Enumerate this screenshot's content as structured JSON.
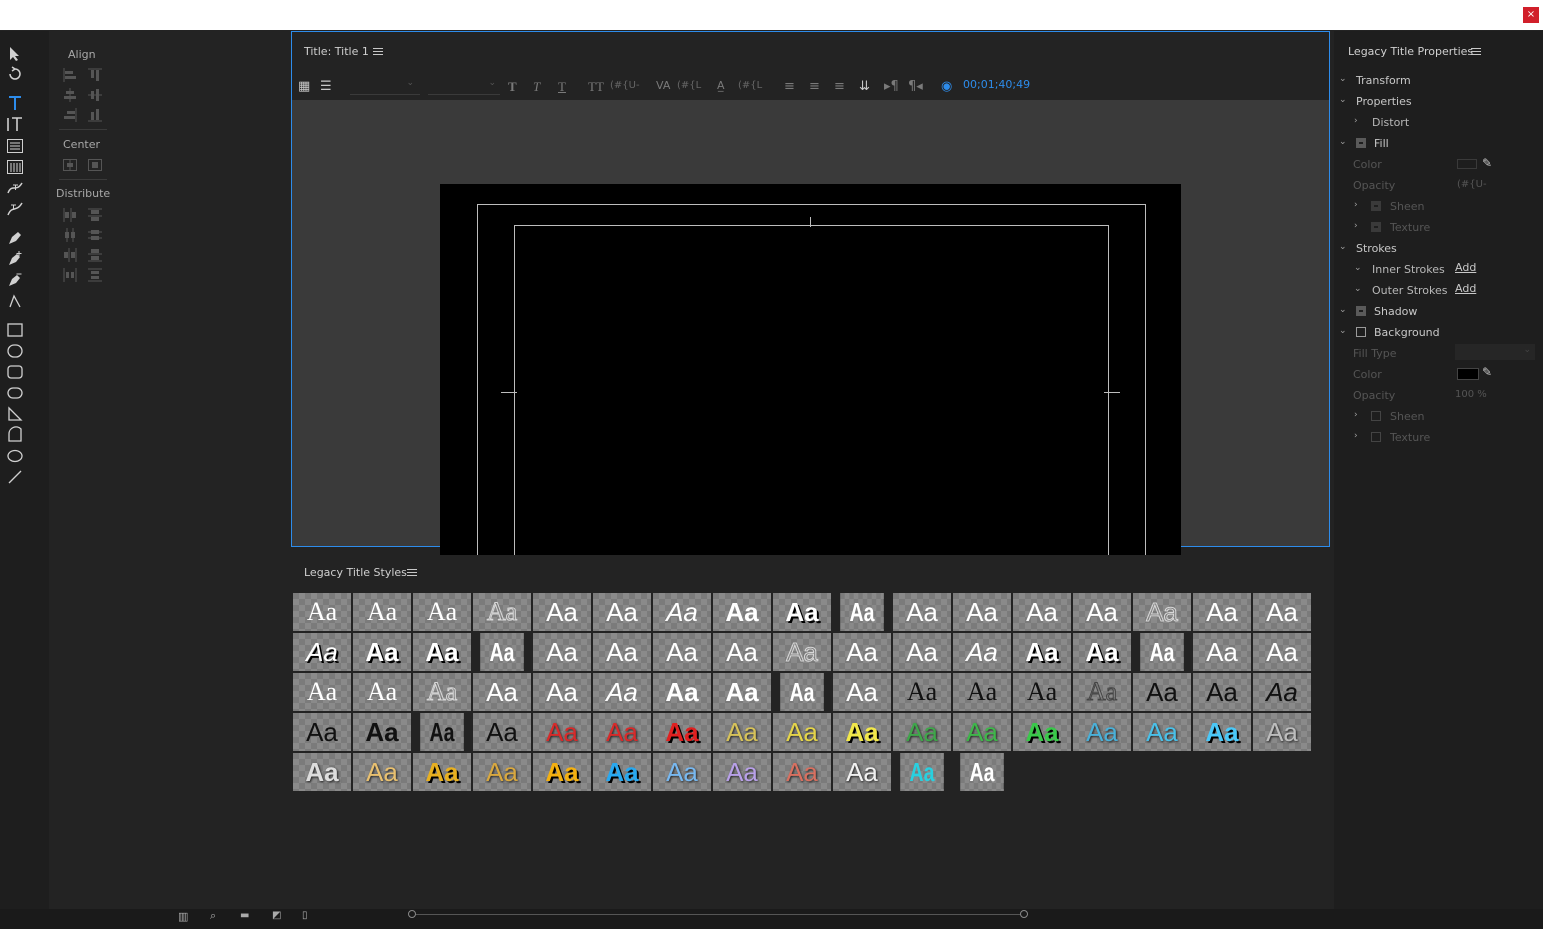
{
  "window": {
    "close_label": "×"
  },
  "align_panel": {
    "align_label": "Align",
    "center_label": "Center",
    "distribute_label": "Distribute"
  },
  "title_panel": {
    "title": "Title: Title 1",
    "timecode": "00;01;40;49",
    "kern_value": "(#{U-",
    "leading_value": "(#{L",
    "baseline_value": "(#{L"
  },
  "styles_panel": {
    "title": "Legacy Title Styles",
    "swatch_text": "Aa",
    "swatches": [
      {
        "fg": "#ffffff",
        "st": "normal",
        "w": "400",
        "fam": "Liberation Serif",
        "fx": ""
      },
      {
        "fg": "#ffffff",
        "st": "normal",
        "w": "400",
        "fam": "Liberation Serif",
        "fx": ""
      },
      {
        "fg": "#ffffff",
        "st": "normal",
        "w": "400",
        "fam": "Liberation Serif",
        "fx": ""
      },
      {
        "fg": "#d8d8d8",
        "st": "normal",
        "w": "400",
        "fam": "Liberation Serif",
        "fx": "outline"
      },
      {
        "fg": "#ffffff",
        "st": "normal",
        "w": "400",
        "fam": "Liberation Sans",
        "fx": ""
      },
      {
        "fg": "#ffffff",
        "st": "normal",
        "w": "400",
        "fam": "Liberation Sans",
        "fx": ""
      },
      {
        "fg": "#ffffff",
        "st": "italic",
        "w": "400",
        "fam": "Liberation Sans",
        "fx": ""
      },
      {
        "fg": "#ffffff",
        "st": "normal",
        "w": "700",
        "fam": "Liberation Sans",
        "fx": ""
      },
      {
        "fg": "#ffffff",
        "st": "normal",
        "w": "700",
        "fam": "Liberation Sans",
        "fx": "shadow"
      },
      {
        "fg": "#ffffff",
        "st": "normal",
        "w": "700",
        "fam": "Liberation Sans",
        "fx": "condensed"
      },
      {
        "fg": "#ffffff",
        "st": "normal",
        "w": "400",
        "fam": "Liberation Sans",
        "fx": ""
      },
      {
        "fg": "#ffffff",
        "st": "normal",
        "w": "400",
        "fam": "Liberation Sans",
        "fx": ""
      },
      {
        "fg": "#ffffff",
        "st": "normal",
        "w": "400",
        "fam": "Liberation Sans",
        "fx": ""
      },
      {
        "fg": "#ffffff",
        "st": "normal",
        "w": "400",
        "fam": "Liberation Sans",
        "fx": ""
      },
      {
        "fg": "#d8d8d8",
        "st": "normal",
        "w": "400",
        "fam": "Liberation Sans",
        "fx": "outline"
      },
      {
        "fg": "#ffffff",
        "st": "normal",
        "w": "400",
        "fam": "Liberation Sans",
        "fx": ""
      },
      {
        "fg": "#ffffff",
        "st": "normal",
        "w": "400",
        "fam": "Liberation Sans",
        "fx": ""
      },
      {
        "fg": "#ffffff",
        "st": "italic",
        "w": "400",
        "fam": "Liberation Sans",
        "fx": "shadow"
      },
      {
        "fg": "#ffffff",
        "st": "normal",
        "w": "700",
        "fam": "Liberation Sans",
        "fx": "shadow"
      },
      {
        "fg": "#ffffff",
        "st": "normal",
        "w": "700",
        "fam": "Liberation Sans",
        "fx": "shadow"
      },
      {
        "fg": "#ffffff",
        "st": "normal",
        "w": "700",
        "fam": "Liberation Sans",
        "fx": "condensed"
      },
      {
        "fg": "#ffffff",
        "st": "normal",
        "w": "400",
        "fam": "Liberation Sans",
        "fx": ""
      },
      {
        "fg": "#ffffff",
        "st": "normal",
        "w": "400",
        "fam": "Liberation Sans",
        "fx": ""
      },
      {
        "fg": "#ffffff",
        "st": "normal",
        "w": "400",
        "fam": "Liberation Sans",
        "fx": ""
      },
      {
        "fg": "#ffffff",
        "st": "normal",
        "w": "400",
        "fam": "Liberation Sans",
        "fx": ""
      },
      {
        "fg": "#d8d8d8",
        "st": "normal",
        "w": "400",
        "fam": "Liberation Sans",
        "fx": "outline"
      },
      {
        "fg": "#ffffff",
        "st": "normal",
        "w": "400",
        "fam": "Liberation Sans",
        "fx": ""
      },
      {
        "fg": "#ffffff",
        "st": "normal",
        "w": "400",
        "fam": "Liberation Sans",
        "fx": ""
      },
      {
        "fg": "#ffffff",
        "st": "italic",
        "w": "400",
        "fam": "Liberation Sans",
        "fx": ""
      },
      {
        "fg": "#ffffff",
        "st": "normal",
        "w": "700",
        "fam": "Liberation Sans",
        "fx": "shadow"
      },
      {
        "fg": "#ffffff",
        "st": "normal",
        "w": "700",
        "fam": "Liberation Sans",
        "fx": "shadow"
      },
      {
        "fg": "#ffffff",
        "st": "normal",
        "w": "700",
        "fam": "Liberation Sans",
        "fx": "condensed"
      },
      {
        "fg": "#ffffff",
        "st": "normal",
        "w": "400",
        "fam": "Liberation Sans",
        "fx": ""
      },
      {
        "fg": "#ffffff",
        "st": "normal",
        "w": "400",
        "fam": "Liberation Sans",
        "fx": ""
      },
      {
        "fg": "#ffffff",
        "st": "normal",
        "w": "400",
        "fam": "Liberation Serif",
        "fx": ""
      },
      {
        "fg": "#ffffff",
        "st": "normal",
        "w": "400",
        "fam": "Liberation Serif",
        "fx": ""
      },
      {
        "fg": "#d8d8d8",
        "st": "normal",
        "w": "400",
        "fam": "Liberation Serif",
        "fx": "outline"
      },
      {
        "fg": "#ffffff",
        "st": "normal",
        "w": "400",
        "fam": "Liberation Sans",
        "fx": ""
      },
      {
        "fg": "#ffffff",
        "st": "normal",
        "w": "400",
        "fam": "Liberation Sans",
        "fx": ""
      },
      {
        "fg": "#ffffff",
        "st": "italic",
        "w": "400",
        "fam": "Liberation Sans",
        "fx": ""
      },
      {
        "fg": "#ffffff",
        "st": "normal",
        "w": "700",
        "fam": "Liberation Sans",
        "fx": ""
      },
      {
        "fg": "#ffffff",
        "st": "normal",
        "w": "700",
        "fam": "Liberation Sans",
        "fx": ""
      },
      {
        "fg": "#ffffff",
        "st": "normal",
        "w": "700",
        "fam": "Liberation Sans",
        "fx": "condensed"
      },
      {
        "fg": "#ffffff",
        "st": "normal",
        "w": "400",
        "fam": "Liberation Sans",
        "fx": ""
      },
      {
        "fg": "#111111",
        "st": "normal",
        "w": "400",
        "fam": "Liberation Serif",
        "fx": ""
      },
      {
        "fg": "#111111",
        "st": "normal",
        "w": "400",
        "fam": "Liberation Serif",
        "fx": ""
      },
      {
        "fg": "#111111",
        "st": "normal",
        "w": "400",
        "fam": "Liberation Serif",
        "fx": ""
      },
      {
        "fg": "#444444",
        "st": "normal",
        "w": "400",
        "fam": "Liberation Serif",
        "fx": "outline"
      },
      {
        "fg": "#111111",
        "st": "normal",
        "w": "400",
        "fam": "Liberation Sans",
        "fx": ""
      },
      {
        "fg": "#111111",
        "st": "normal",
        "w": "400",
        "fam": "Liberation Sans",
        "fx": ""
      },
      {
        "fg": "#111111",
        "st": "italic",
        "w": "400",
        "fam": "Liberation Sans",
        "fx": ""
      },
      {
        "fg": "#111111",
        "st": "normal",
        "w": "400",
        "fam": "Liberation Sans",
        "fx": ""
      },
      {
        "fg": "#111111",
        "st": "normal",
        "w": "700",
        "fam": "Liberation Sans",
        "fx": ""
      },
      {
        "fg": "#111111",
        "st": "normal",
        "w": "700",
        "fam": "Liberation Sans",
        "fx": "condensed"
      },
      {
        "fg": "#111111",
        "st": "normal",
        "w": "400",
        "fam": "Liberation Sans",
        "fx": ""
      },
      {
        "fg": "#d82a2a",
        "st": "normal",
        "w": "400",
        "fam": "Liberation Sans",
        "fx": "glow"
      },
      {
        "fg": "#d82a2a",
        "st": "normal",
        "w": "400",
        "fam": "Liberation Sans",
        "fx": "glow"
      },
      {
        "fg": "#e02020",
        "st": "normal",
        "w": "700",
        "fam": "Liberation Sans",
        "fx": "shadow"
      },
      {
        "fg": "#d6c25a",
        "st": "normal",
        "w": "400",
        "fam": "Liberation Sans",
        "fx": "glow"
      },
      {
        "fg": "#e4d44a",
        "st": "normal",
        "w": "400",
        "fam": "Liberation Sans",
        "fx": "glow"
      },
      {
        "fg": "#f2e84a",
        "st": "normal",
        "w": "700",
        "fam": "Liberation Sans",
        "fx": "shadow"
      },
      {
        "fg": "#3fa64a",
        "st": "normal",
        "w": "400",
        "fam": "Liberation Sans",
        "fx": "glow"
      },
      {
        "fg": "#3fb64a",
        "st": "normal",
        "w": "400",
        "fam": "Liberation Sans",
        "fx": "glow"
      },
      {
        "fg": "#3ac84a",
        "st": "normal",
        "w": "700",
        "fam": "Liberation Sans",
        "fx": "shadow"
      },
      {
        "fg": "#4ab0d8",
        "st": "normal",
        "w": "400",
        "fam": "Liberation Sans",
        "fx": "glow"
      },
      {
        "fg": "#4ac0e8",
        "st": "normal",
        "w": "400",
        "fam": "Liberation Sans",
        "fx": "glow"
      },
      {
        "fg": "#4ac8f8",
        "st": "normal",
        "w": "700",
        "fam": "Liberation Sans",
        "fx": "shadow"
      },
      {
        "fg": "#bdbdbd",
        "st": "normal",
        "w": "400",
        "fam": "Liberation Sans",
        "fx": "glow"
      },
      {
        "fg": "#dddddd",
        "st": "normal",
        "w": "700",
        "fam": "Liberation Sans",
        "fx": "glow"
      },
      {
        "fg": "#e8c070",
        "st": "normal",
        "w": "400",
        "fam": "Liberation Sans",
        "fx": "glow"
      },
      {
        "fg": "#e8b020",
        "st": "normal",
        "w": "700",
        "fam": "Liberation Sans",
        "fx": "shadow"
      },
      {
        "fg": "#d8a840",
        "st": "normal",
        "w": "400",
        "fam": "Liberation Sans",
        "fx": "glow"
      },
      {
        "fg": "#f4b010",
        "st": "normal",
        "w": "700",
        "fam": "Liberation Sans",
        "fx": "shadow"
      },
      {
        "fg": "#28a8f0",
        "st": "normal",
        "w": "700",
        "fam": "Liberation Sans",
        "fx": "shadow"
      },
      {
        "fg": "#78b8f0",
        "st": "normal",
        "w": "400",
        "fam": "Liberation Sans",
        "fx": "glow"
      },
      {
        "fg": "#b8a0e8",
        "st": "normal",
        "w": "400",
        "fam": "Liberation Sans",
        "fx": "glow"
      },
      {
        "fg": "#d87060",
        "st": "normal",
        "w": "400",
        "fam": "Liberation Sans",
        "fx": "glow"
      },
      {
        "fg": "#f0f0f0",
        "st": "normal",
        "w": "400",
        "fam": "Liberation Sans",
        "fx": "glow"
      },
      {
        "fg": "#28d0e0",
        "st": "normal",
        "w": "400",
        "fam": "Liberation Sans",
        "fx": "condensed"
      },
      {
        "fg": "#ffffff",
        "st": "normal",
        "w": "400",
        "fam": "Liberation Sans",
        "fx": "condensed"
      }
    ]
  },
  "props_panel": {
    "title": "Legacy Title Properties",
    "transform": "Transform",
    "properties": "Properties",
    "distort": "Distort",
    "fill": "Fill",
    "fill_color": "Color",
    "fill_opacity": "Opacity",
    "fill_opacity_value": "(#{U-",
    "fill_sheen": "Sheen",
    "fill_texture": "Texture",
    "strokes": "Strokes",
    "inner_strokes": "Inner Strokes",
    "outer_strokes": "Outer Strokes",
    "add_label": "Add",
    "shadow": "Shadow",
    "background": "Background",
    "fill_type": "Fill Type",
    "bg_color": "Color",
    "bg_opacity": "Opacity",
    "bg_opacity_value": "100 %",
    "bg_sheen": "Sheen",
    "bg_texture": "Texture"
  }
}
